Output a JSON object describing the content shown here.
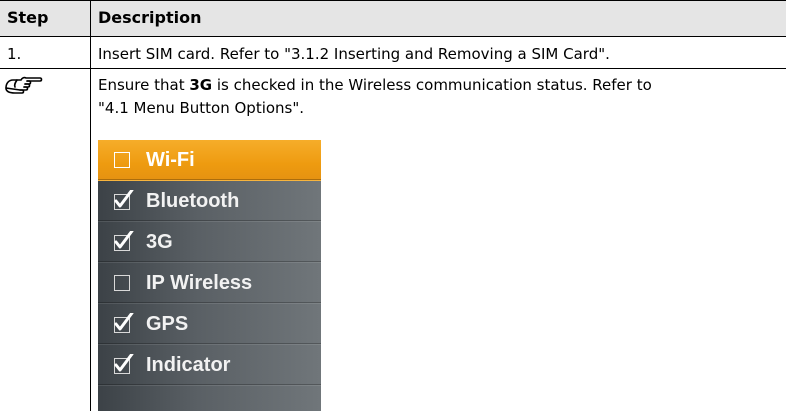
{
  "table": {
    "headers": {
      "step": "Step",
      "description": "Description"
    },
    "rows": [
      {
        "step": "1.",
        "description": "Insert SIM card. Refer to \"3.1.2 Inserting and Removing a SIM Card\"."
      },
      {
        "step_icon": "pointing-hand-icon",
        "description_before": "Ensure that ",
        "description_bold": "3G",
        "description_after": " is checked in the Wireless communication status. Refer to",
        "description_line2": "\"4.1 Menu Button Options\"."
      }
    ]
  },
  "wireless_panel": {
    "items": [
      {
        "label": "Wi-Fi",
        "checked": false,
        "highlighted": true
      },
      {
        "label": "Bluetooth",
        "checked": true
      },
      {
        "label": "3G",
        "checked": true
      },
      {
        "label": "IP Wireless",
        "checked": false
      },
      {
        "label": "GPS",
        "checked": true
      },
      {
        "label": "Indicator",
        "checked": true
      }
    ],
    "colors": {
      "highlight": "#f0a01a",
      "background": "#5a6065",
      "text": "#f2f2f2"
    }
  }
}
